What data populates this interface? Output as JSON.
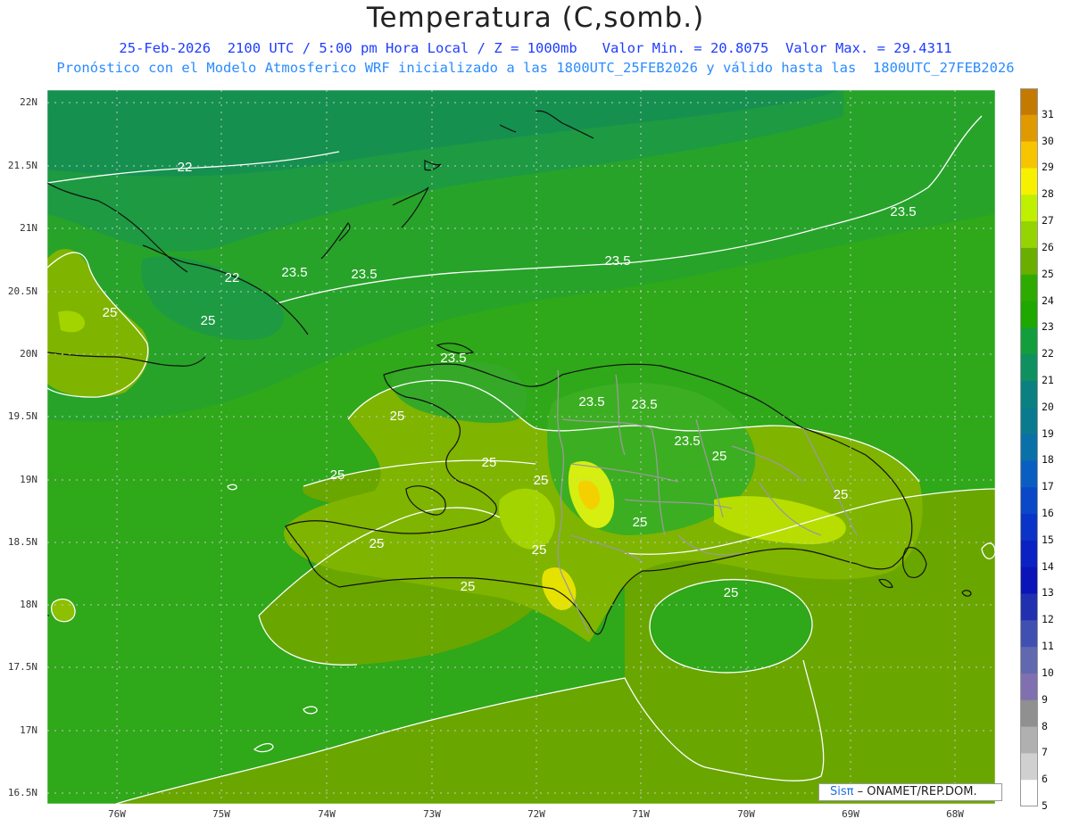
{
  "header": {
    "title": "Temperatura (C,somb.)",
    "line1": "25-Feb-2026  2100 UTC / 5:00 pm Hora Local / Z = 1000mb   Valor Min. = 20.8075  Valor Max. = 29.4311",
    "line2": "Pronóstico con el Modelo Atmosferico WRF inicializado a las 1800UTC_25FEB2026 y válido hasta las  1800UTC_27FEB2026"
  },
  "map": {
    "lat_labels": [
      "22N",
      "21.5N",
      "21N",
      "20.5N",
      "20N",
      "19.5N",
      "19N",
      "18.5N",
      "18N",
      "17.5N",
      "17N",
      "16.5N"
    ],
    "lon_labels": [
      "76W",
      "75W",
      "74W",
      "73W",
      "72W",
      "71W",
      "70W",
      "69W",
      "68W"
    ],
    "contour_labels": [
      {
        "text": "22"
      },
      {
        "text": "22"
      },
      {
        "text": "23.5"
      },
      {
        "text": "23.5"
      },
      {
        "text": "23.5"
      },
      {
        "text": "23.5"
      },
      {
        "text": "23.5"
      },
      {
        "text": "23.5"
      },
      {
        "text": "23.5"
      },
      {
        "text": "23.5"
      },
      {
        "text": "25"
      },
      {
        "text": "25"
      },
      {
        "text": "25"
      },
      {
        "text": "25"
      },
      {
        "text": "25"
      },
      {
        "text": "25"
      },
      {
        "text": "25"
      },
      {
        "text": "25"
      },
      {
        "text": "25"
      },
      {
        "text": "25"
      },
      {
        "text": "25"
      },
      {
        "text": "25"
      },
      {
        "text": "25"
      }
    ],
    "credit_brand": "Sisπ",
    "credit_text": "– ONAMET/REP.DOM."
  },
  "colorbar": {
    "labels": [
      "31",
      "30",
      "29",
      "28",
      "27",
      "26",
      "25",
      "24",
      "23",
      "22",
      "21",
      "20",
      "19",
      "18",
      "17",
      "16",
      "15",
      "14",
      "13",
      "12",
      "11",
      "10",
      "9",
      "8",
      "7",
      "6",
      "5"
    ],
    "colors": [
      "#c47a00",
      "#e09a00",
      "#f7c400",
      "#f7f000",
      "#bff000",
      "#94d400",
      "#6aae00",
      "#2faa00",
      "#1ea800",
      "#139e3c",
      "#0f9060",
      "#0a8080",
      "#0a7a8e",
      "#0a70a8",
      "#0a5ec2",
      "#0a48c8",
      "#0a34c8",
      "#0a22c4",
      "#0a14b8",
      "#2030b0",
      "#4050b0",
      "#6068b0",
      "#8070b0",
      "#909090",
      "#b0b0b0",
      "#d0d0d0",
      "#ffffff"
    ]
  }
}
